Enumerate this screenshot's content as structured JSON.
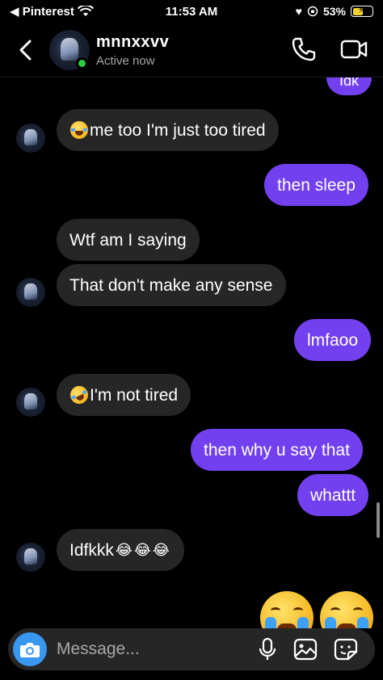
{
  "status_bar": {
    "back_app": "◀ Pinterest",
    "time": "11:53 AM",
    "battery": "53%",
    "battery_level": 0.53
  },
  "header": {
    "contact_name": "mnnxxvv",
    "status": "Active now"
  },
  "messages": [
    {
      "id": "m0",
      "direction": "out",
      "text": "Idk"
    },
    {
      "id": "m1",
      "direction": "in",
      "emoji": "joy",
      "text": "me too I'm just too tired"
    },
    {
      "id": "m2",
      "direction": "out",
      "text": "then sleep"
    },
    {
      "id": "m3",
      "direction": "in",
      "text": "Wtf am I saying"
    },
    {
      "id": "m4",
      "direction": "in",
      "text": "That don't make any sense"
    },
    {
      "id": "m5",
      "direction": "out",
      "text": "lmfaoo"
    },
    {
      "id": "m6",
      "direction": "in",
      "emoji": "rofl",
      "text": "I'm not tired"
    },
    {
      "id": "m7",
      "direction": "out",
      "text": "then why u say that"
    },
    {
      "id": "m8",
      "direction": "out",
      "text": "whattt"
    },
    {
      "id": "m9",
      "direction": "in",
      "text": "Idfkkk",
      "trailing_emoji": "😂😂😂"
    },
    {
      "id": "m10",
      "direction": "out",
      "emoji_only": "😭😭"
    }
  ],
  "composer": {
    "placeholder": "Message..."
  },
  "icons": [
    "back-icon",
    "phone-icon",
    "video-call-icon",
    "camera-icon",
    "microphone-icon",
    "gallery-icon",
    "sticker-icon"
  ],
  "colors": {
    "outgoing_bubble": "#7340f0",
    "incoming_bubble": "#262626",
    "online": "#2ecc40",
    "camera_button": "#3897f0"
  }
}
